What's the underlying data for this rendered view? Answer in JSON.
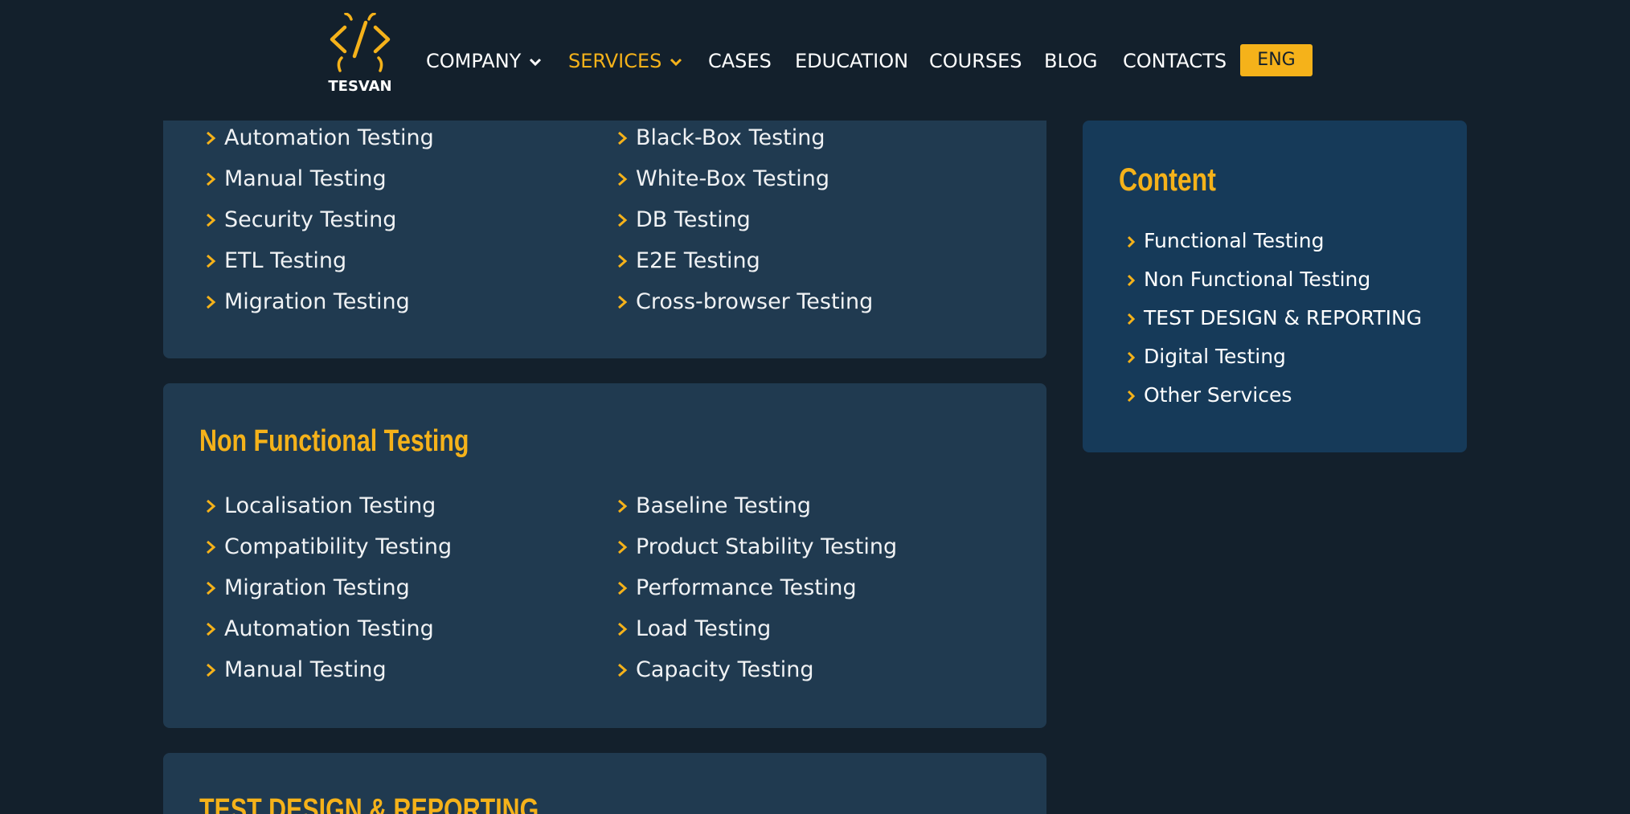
{
  "brand": {
    "name": "TESVAN"
  },
  "colors": {
    "accent": "#f5b21a",
    "background": "#13202c",
    "card": "#203a50",
    "sidebar": "#163a59"
  },
  "nav": {
    "items": [
      {
        "label": "COMPANY",
        "has_dropdown": true,
        "active": false
      },
      {
        "label": "SERVICES",
        "has_dropdown": true,
        "active": true
      },
      {
        "label": "CASES"
      },
      {
        "label": "EDUCATION"
      },
      {
        "label": "COURSES"
      },
      {
        "label": "BLOG"
      },
      {
        "label": "CONTACTS"
      }
    ],
    "language": "ENG"
  },
  "sections": [
    {
      "title": "",
      "left": [
        "Automation Testing",
        "Manual Testing",
        "Security Testing",
        "ETL Testing",
        "Migration Testing"
      ],
      "right": [
        "Black-Box Testing",
        "White-Box Testing",
        "DB Testing",
        "E2E Testing",
        "Cross-browser Testing"
      ]
    },
    {
      "title": "Non Functional Testing",
      "left": [
        "Localisation Testing",
        "Compatibility Testing",
        "Migration Testing",
        "Automation Testing",
        "Manual Testing"
      ],
      "right": [
        "Baseline Testing",
        "Product Stability Testing",
        "Performance Testing",
        "Load Testing",
        "Capacity Testing"
      ]
    },
    {
      "title": "TEST DESIGN & REPORTING"
    }
  ],
  "sidebar": {
    "title": "Content",
    "items": [
      "Functional Testing",
      "Non Functional Testing",
      "TEST DESIGN & REPORTING",
      "Digital Testing",
      "Other Services"
    ]
  }
}
